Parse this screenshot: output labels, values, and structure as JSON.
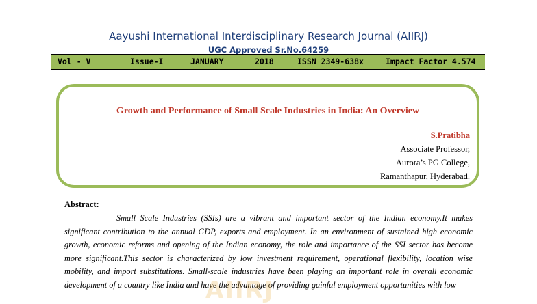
{
  "header": {
    "journal_title": "Aayushi International Interdisciplinary Research Journal (AIIRJ)",
    "ugc_line": "UGC Approved Sr.No.64259",
    "info_bar": {
      "volume": "Vol - V",
      "issue": "Issue-I",
      "month": "JANUARY",
      "year": "2018",
      "issn": "ISSN 2349-638x",
      "impact_factor": "Impact Factor 4.574"
    }
  },
  "paper": {
    "title": "Growth and Performance of Small Scale Industries in India: An Overview",
    "author": {
      "name": "S.Pratibha",
      "position": "Associate Professor,",
      "institution": "Aurora’s PG College,",
      "location": "Ramanthapur, Hyderabad."
    }
  },
  "abstract": {
    "heading": "Abstract:",
    "body": "Small Scale Industries (SSIs) are a vibrant and important sector of the Indian economy.It makes significant contribution to the annual GDP, exports and employment. In an environment of sustained high economic growth, economic reforms and opening of the Indian economy, the role and importance of the SSI sector has become more significant.This sector is characterized by low investment requirement, operational flexibility, location wise mobility, and import substitutions. Small-scale industries have been playing an important role in overall economic development of a country like India and have the advantage of providing gainful employment opportunities with low"
  }
}
